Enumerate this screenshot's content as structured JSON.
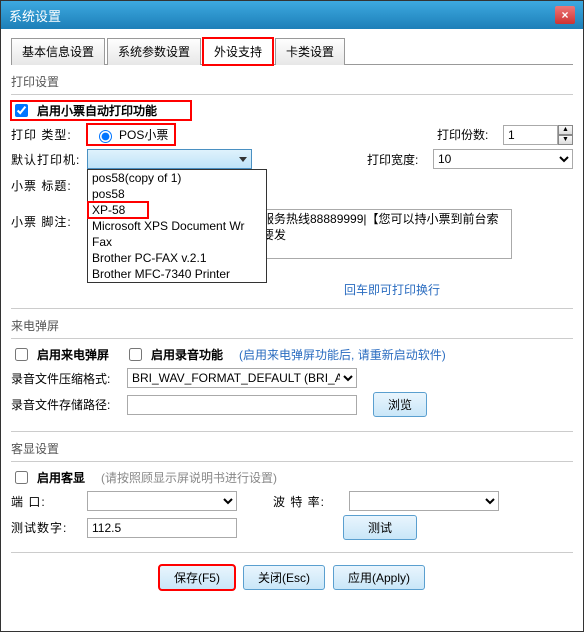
{
  "title": "系统设置",
  "tabs": [
    "基本信息设置",
    "系统参数设置",
    "外设支持",
    "卡类设置"
  ],
  "print": {
    "section": "打印设置",
    "enable_auto": "启用小票自动打印功能",
    "type_label": "打印 类型:",
    "type_value": "POS小票",
    "copies_label": "打印份数:",
    "copies_value": "1",
    "default_printer_label": "默认打印机:",
    "width_label": "打印宽度:",
    "width_value": "10",
    "printers": [
      "pos58(copy of 1)",
      "pos58",
      "XP-58",
      "Microsoft XPS Document Wr",
      "Fax",
      "Brother PC-FAX v.2.1",
      "Brother MFC-7340 Printer"
    ],
    "title_label": "小票 标题:",
    "footer_label": "小票 脚注:",
    "footer_text": "服务热线88889999|【您可以持小票到前台索要发",
    "hint": "回车即可打印换行"
  },
  "caller": {
    "section": "来电弹屏",
    "enable_caller": "启用来电弹屏",
    "enable_record": "启用录音功能",
    "note": "(启用来电弹屏功能后, 请重新启动软件)",
    "format_label": "录音文件压缩格式:",
    "format_value": "BRI_WAV_FORMAT_DEFAULT (BRI_AUDI",
    "path_label": "录音文件存储路径:",
    "browse": "浏览"
  },
  "display": {
    "section": "客显设置",
    "enable": "启用客显",
    "note": "(请按照顾显示屏说明书进行设置)",
    "port_label": "端    口:",
    "baud_label": "波 特 率:",
    "test_num_label": "测试数字:",
    "test_num_value": "112.5",
    "test_btn": "测试"
  },
  "buttons": {
    "save": "保存(F5)",
    "close": "关闭(Esc)",
    "apply": "应用(Apply)"
  }
}
